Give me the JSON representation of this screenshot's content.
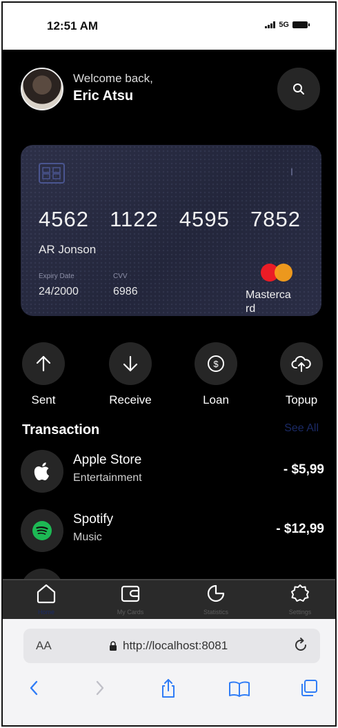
{
  "status": {
    "time": "12:51 AM",
    "network": "5G"
  },
  "header": {
    "welcome": "Welcome back,",
    "name": "Eric Atsu"
  },
  "card": {
    "number_groups": [
      "4562",
      "1122",
      "4595",
      "7852"
    ],
    "holder": "AR Jonson",
    "expiry_label": "Expiry Date",
    "expiry_value": "24/2000",
    "cvv_label": "CVV",
    "cvv_value": "6986",
    "network_label": "Mastercard",
    "colors": {
      "background": "#262a40",
      "mc_red": "#eb1c26",
      "mc_orange": "#f79e1b"
    }
  },
  "actions": [
    {
      "label": "Sent",
      "icon": "arrow-up-icon"
    },
    {
      "label": "Receive",
      "icon": "arrow-down-icon"
    },
    {
      "label": "Loan",
      "icon": "dollar-coin-icon"
    },
    {
      "label": "Topup",
      "icon": "cloud-upload-icon"
    }
  ],
  "transactions": {
    "title": "Transaction",
    "see_all": "See All",
    "items": [
      {
        "name": "Apple Store",
        "category": "Entertainment",
        "amount": "- $5,99",
        "icon": "apple-icon"
      },
      {
        "name": "Spotify",
        "category": "Music",
        "amount": "- $12,99",
        "icon": "spotify-icon"
      }
    ]
  },
  "tabbar": {
    "items": [
      {
        "label": "Home",
        "icon": "home-icon",
        "active": true
      },
      {
        "label": "My Cards",
        "icon": "wallet-icon",
        "active": false
      },
      {
        "label": "Statistics",
        "icon": "pie-chart-icon",
        "active": false
      },
      {
        "label": "Settings",
        "icon": "settings-gear-icon",
        "active": false
      }
    ]
  },
  "browser": {
    "text_size_label": "AA",
    "url": "http://localhost:8081"
  }
}
